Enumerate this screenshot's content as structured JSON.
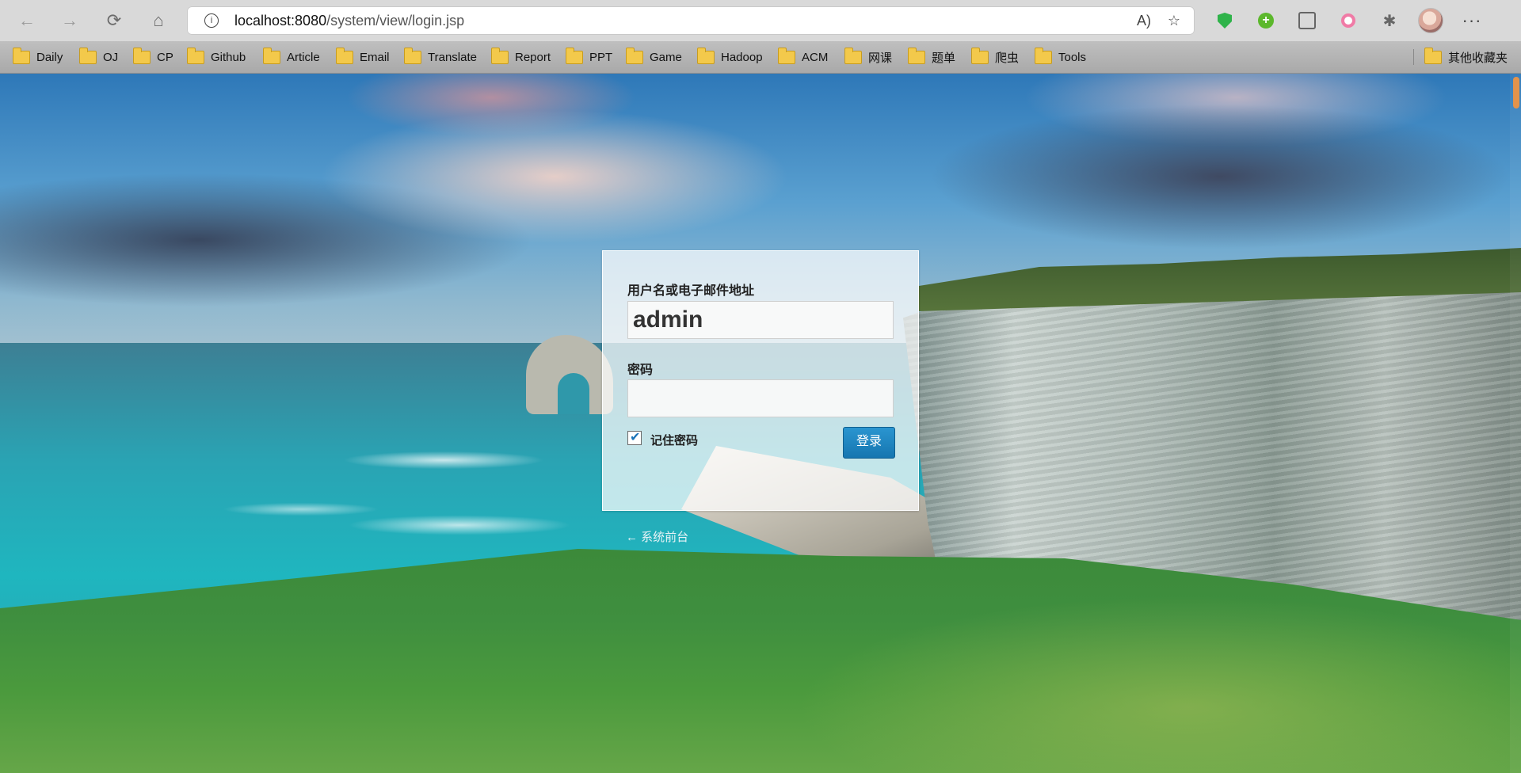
{
  "browser": {
    "url_host": "localhost:8080",
    "url_path": "/system/view/login.jsp",
    "nav": {
      "back_icon": "←",
      "forward_icon": "→",
      "refresh_icon": "⟳",
      "home_icon": "⌂"
    },
    "bookmarks": [
      {
        "label": "Daily"
      },
      {
        "label": "OJ"
      },
      {
        "label": "CP"
      },
      {
        "label": "Github"
      },
      {
        "label": "Article"
      },
      {
        "label": "Email"
      },
      {
        "label": "Translate"
      },
      {
        "label": "Report"
      },
      {
        "label": "PPT"
      },
      {
        "label": "Game"
      },
      {
        "label": "Hadoop"
      },
      {
        "label": "ACM"
      },
      {
        "label": "网课"
      },
      {
        "label": "题单"
      },
      {
        "label": "爬虫"
      },
      {
        "label": "Tools"
      }
    ],
    "other_bookmarks": "其他收藏夹"
  },
  "login": {
    "username_label": "用户名或电子邮件地址",
    "username_value": "admin",
    "password_label": "密码",
    "password_value": "",
    "remember_label": "记住密码",
    "remember_checked": true,
    "submit_label": "登录",
    "back_link": "← 系统前台"
  }
}
